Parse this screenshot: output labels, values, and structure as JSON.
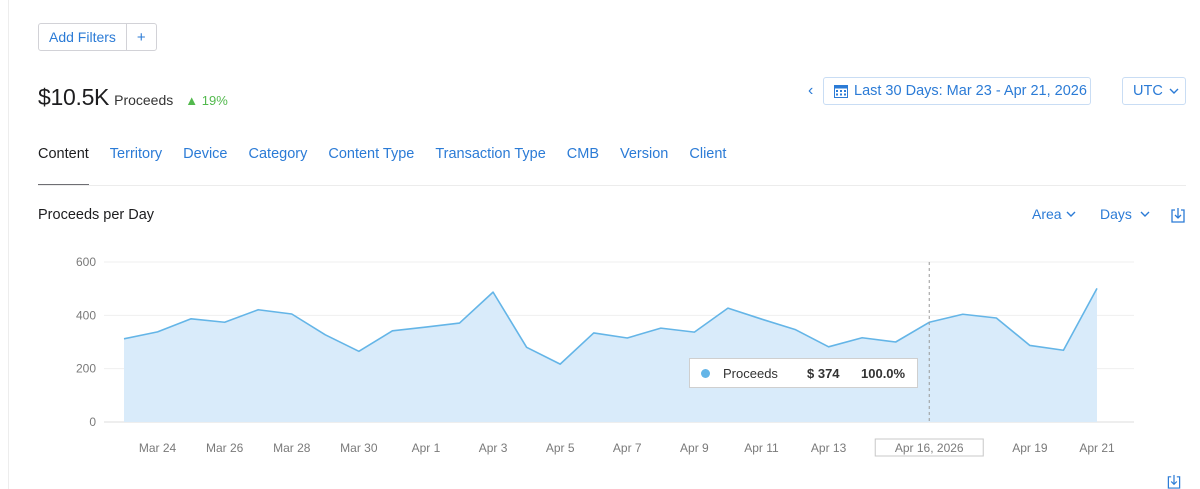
{
  "filters": {
    "add_label": "Add Filters",
    "plus_label": "+"
  },
  "headline": {
    "amount": "$10.5K",
    "metric": "Proceeds",
    "delta": "▲ 19%"
  },
  "date_range": {
    "prev_icon": "‹",
    "icon": "calendar-icon",
    "label": "Last 30 Days: Mar 23 - Apr 21, 2026"
  },
  "timezone": {
    "label": "UTC",
    "icon": "chevron-down-icon"
  },
  "tabs": [
    {
      "label": "Content",
      "active": true
    },
    {
      "label": "Territory"
    },
    {
      "label": "Device"
    },
    {
      "label": "Category"
    },
    {
      "label": "Content Type"
    },
    {
      "label": "Transaction Type"
    },
    {
      "label": "CMB"
    },
    {
      "label": "Version"
    },
    {
      "label": "Client"
    }
  ],
  "chart_header": {
    "title": "Proceeds per Day",
    "type_label": "Area",
    "interval_label": "Days",
    "download_icon": "download-icon"
  },
  "colors": {
    "accent": "#2b7bd6",
    "series_line": "#64b5e7",
    "series_fill": "#d9ebfa",
    "positive": "#52b94d"
  },
  "tooltip": {
    "series": "Proceeds",
    "value": "$ 374",
    "percent": "100.0%"
  },
  "chart_data": {
    "type": "area",
    "x": [
      "Mar 23",
      "Mar 24",
      "Mar 25",
      "Mar 26",
      "Mar 27",
      "Mar 28",
      "Mar 29",
      "Mar 30",
      "Mar 31",
      "Apr 1",
      "Apr 2",
      "Apr 3",
      "Apr 4",
      "Apr 5",
      "Apr 6",
      "Apr 7",
      "Apr 8",
      "Apr 9",
      "Apr 10",
      "Apr 11",
      "Apr 12",
      "Apr 13",
      "Apr 14",
      "Apr 15",
      "Apr 16",
      "Apr 17",
      "Apr 18",
      "Apr 19",
      "Apr 20",
      "Apr 21"
    ],
    "x_tick_labels": [
      "Mar 24",
      "Mar 26",
      "Mar 28",
      "Mar 30",
      "Apr 1",
      "Apr 3",
      "Apr 5",
      "Apr 7",
      "Apr 9",
      "Apr 11",
      "Apr 13",
      "Apr 16, 2026",
      "Apr 19",
      "Apr 21"
    ],
    "x_tick_index": [
      1,
      3,
      5,
      7,
      9,
      11,
      13,
      15,
      17,
      19,
      21,
      24,
      27,
      29
    ],
    "series": [
      {
        "name": "Proceeds",
        "values": [
          312,
          338,
          387,
          374,
          421,
          405,
          327,
          265,
          342,
          356,
          371,
          487,
          280,
          217,
          334,
          315,
          352,
          337,
          427,
          386,
          347,
          282,
          316,
          300,
          374,
          404,
          390,
          287,
          269,
          501
        ]
      }
    ],
    "y_ticks": [
      0,
      200,
      400,
      600
    ],
    "ylim": [
      0,
      600
    ],
    "highlight_index": 24,
    "grid": true,
    "legend": "none"
  }
}
